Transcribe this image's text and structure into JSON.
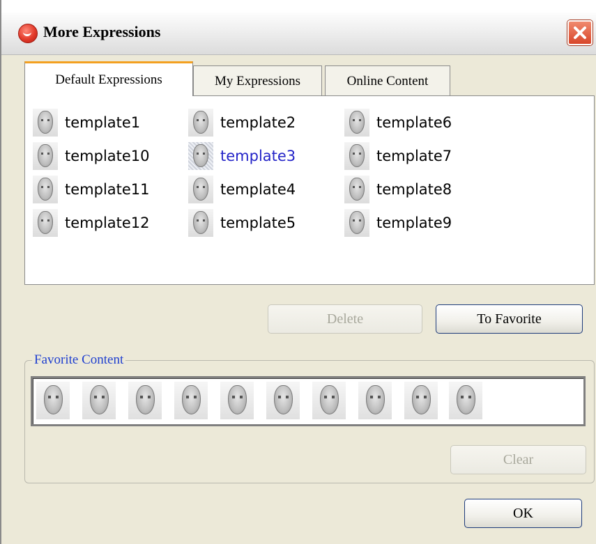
{
  "window": {
    "title": "More Expressions",
    "close_icon": "close-x-icon",
    "app_icon": "app-logo-icon"
  },
  "tabs": [
    {
      "label": "Default Expressions",
      "active": true
    },
    {
      "label": "My Expressions",
      "active": false
    },
    {
      "label": "Online Content",
      "active": false
    }
  ],
  "templates": [
    {
      "label": "template1",
      "selected": false
    },
    {
      "label": "template10",
      "selected": false
    },
    {
      "label": "template11",
      "selected": false
    },
    {
      "label": "template12",
      "selected": false
    },
    {
      "label": "template2",
      "selected": false
    },
    {
      "label": "template3",
      "selected": true
    },
    {
      "label": "template4",
      "selected": false
    },
    {
      "label": "template5",
      "selected": false
    },
    {
      "label": "template6",
      "selected": false
    },
    {
      "label": "template7",
      "selected": false
    },
    {
      "label": "template8",
      "selected": false
    },
    {
      "label": "template9",
      "selected": false
    }
  ],
  "buttons": {
    "delete": {
      "label": "Delete",
      "enabled": false
    },
    "to_favorite": {
      "label": "To Favorite",
      "enabled": true
    },
    "clear": {
      "label": "Clear",
      "enabled": false
    },
    "ok": {
      "label": "OK",
      "enabled": true
    }
  },
  "favorite": {
    "group_label": "Favorite Content",
    "item_count": 10,
    "item_icon": "face-thumbnail-icon"
  },
  "colors": {
    "selected_text": "#2323c8",
    "group_label": "#1f3fcf",
    "active_tab_accent": "#f3a020"
  }
}
